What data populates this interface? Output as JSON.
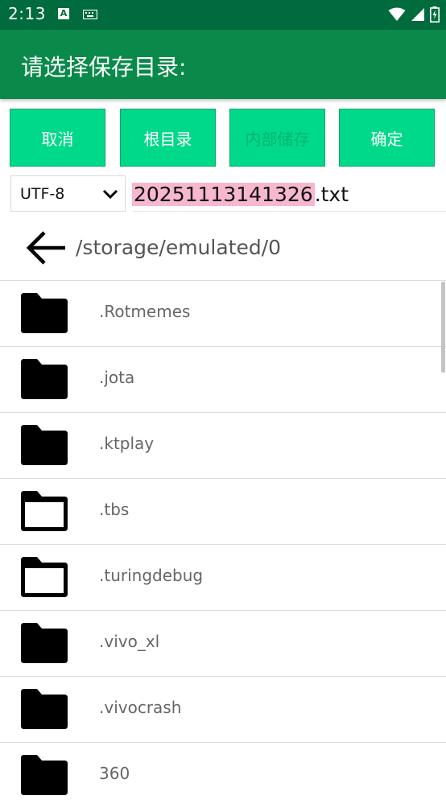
{
  "status_bar": {
    "time": "2:13",
    "a_icon": "A"
  },
  "app_bar": {
    "title": "请选择保存目录:"
  },
  "buttons": {
    "cancel": "取消",
    "root": "根目录",
    "internal": "内部储存",
    "confirm": "确定"
  },
  "encoding": {
    "selected": "UTF-8"
  },
  "filename": {
    "highlighted": "20251113141326",
    "extension": ".txt"
  },
  "path": "/storage/emulated/0",
  "folders": [
    {
      "name": ".Rotmemes",
      "icon": "folder-filled-icon"
    },
    {
      "name": ".jota",
      "icon": "folder-filled-icon"
    },
    {
      "name": ".ktplay",
      "icon": "folder-filled-icon"
    },
    {
      "name": ".tbs",
      "icon": "folder-outline-icon"
    },
    {
      "name": ".turingdebug",
      "icon": "folder-outline-icon"
    },
    {
      "name": ".vivo_xl",
      "icon": "folder-filled-icon"
    },
    {
      "name": ".vivocrash",
      "icon": "folder-filled-icon"
    },
    {
      "name": "360",
      "icon": "folder-filled-icon"
    }
  ],
  "colors": {
    "status_bar": "#006b3c",
    "app_bar": "#0a8a4a",
    "button": "#00d98a",
    "filename_highlight": "#f7b7cf"
  }
}
